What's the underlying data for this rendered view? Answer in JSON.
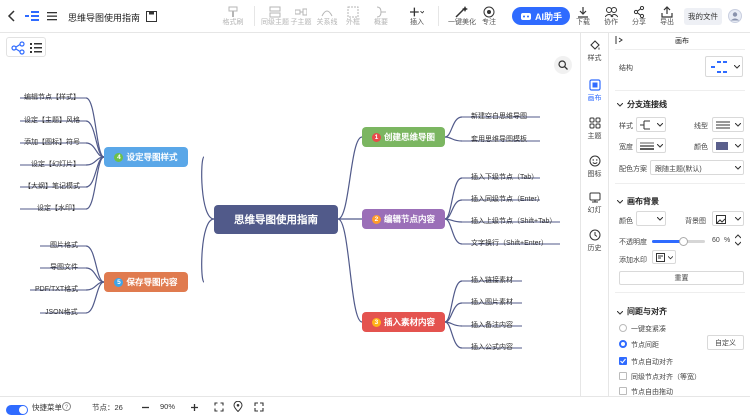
{
  "toolbar": {
    "back_icon": "chevron-left",
    "title": "思维导图使用指南",
    "items": [
      {
        "label": "格式刷",
        "disabled": true
      },
      {
        "label": "同级主题",
        "disabled": true
      },
      {
        "label": "子主题",
        "disabled": true
      },
      {
        "label": "关系线",
        "disabled": true
      },
      {
        "label": "外框",
        "disabled": true
      },
      {
        "label": "概要",
        "disabled": true
      },
      {
        "label": "插入",
        "disabled": false
      },
      {
        "label": "一键美化",
        "disabled": false
      },
      {
        "label": "专注",
        "disabled": false
      }
    ],
    "ai_label": "AI助手",
    "right_items": [
      {
        "label": "下载"
      },
      {
        "label": "协作"
      },
      {
        "label": "分享"
      },
      {
        "label": "导出"
      }
    ],
    "my_files": "我的文件"
  },
  "mindmap": {
    "root": "思维导图使用指南",
    "branches": [
      {
        "num": "1",
        "label": "创建思维导图",
        "color": "#7bb661",
        "numColor": "#e84a4a",
        "leaves": [
          "新建空白思维导图",
          "套用思维导图模板"
        ]
      },
      {
        "num": "2",
        "label": "编辑节点内容",
        "color": "#9b6fb8",
        "numColor": "#ff9c2b",
        "leaves": [
          "插入下级节点（Tab）",
          "插入同级节点（Enter）",
          "插入上级节点（Shift+Tab）",
          "文字换行（Shift+Enter）"
        ]
      },
      {
        "num": "3",
        "label": "插入素材内容",
        "color": "#e4534f",
        "numColor": "#ffb31a",
        "leaves": [
          "插入链接素材",
          "插入图片素材",
          "插入备注内容",
          "插入公式内容"
        ]
      },
      {
        "num": "4",
        "label": "设定导图样式",
        "color": "#5aa7e8",
        "numColor": "#6cc04a",
        "leaves": [
          "编辑节点【样式】",
          "设定【主题】风格",
          "添加【图标】符号",
          "设定【幻灯片】",
          "【大纲】笔记模式",
          "设定【水印】"
        ]
      },
      {
        "num": "5",
        "label": "保存导图内容",
        "color": "#e07b4f",
        "numColor": "#3fa4e8",
        "leaves": [
          "图片格式",
          "导图文件",
          "PDF/TXT格式",
          "JSON格式"
        ]
      }
    ]
  },
  "rail": {
    "items": [
      {
        "icon": "paint-icon",
        "label": "样式",
        "active": false
      },
      {
        "icon": "canvas-icon",
        "label": "画布",
        "active": true
      },
      {
        "icon": "theme-icon",
        "label": "主题",
        "active": false
      },
      {
        "icon": "emoji-icon",
        "label": "图标",
        "active": false
      },
      {
        "icon": "slides-icon",
        "label": "幻灯",
        "active": false
      },
      {
        "icon": "history-icon",
        "label": "历史",
        "active": false
      }
    ]
  },
  "panel": {
    "header": "画布",
    "structure_label": "结构",
    "branch_title": "分支连接线",
    "style_label": "样式",
    "line_type_label": "线型",
    "width_label": "宽度",
    "color_label": "颜色",
    "line_color": "#5a5f8c",
    "scheme_label": "配色方案",
    "scheme_value": "跟随主题(默认)",
    "bg_title": "画布背景",
    "bg_color_label": "颜色",
    "bg_image_label": "背景图",
    "opacity_label": "不透明度",
    "opacity_value": "60",
    "opacity_unit": "%",
    "opacity_fraction": 0.6,
    "watermark_label": "添加水印",
    "reset_label": "重置",
    "spacing_title": "间距与对齐",
    "radio1": "一键变紧凑",
    "radio2": "节点间距",
    "custom_label": "自定义",
    "check1": "节点自动对齐",
    "check2": "同级节点对齐（等宽）",
    "check3": "节点自由拖动"
  },
  "status": {
    "quick_menu": "快捷菜单",
    "nodes_label": "节点：26",
    "zoom": "90%"
  }
}
